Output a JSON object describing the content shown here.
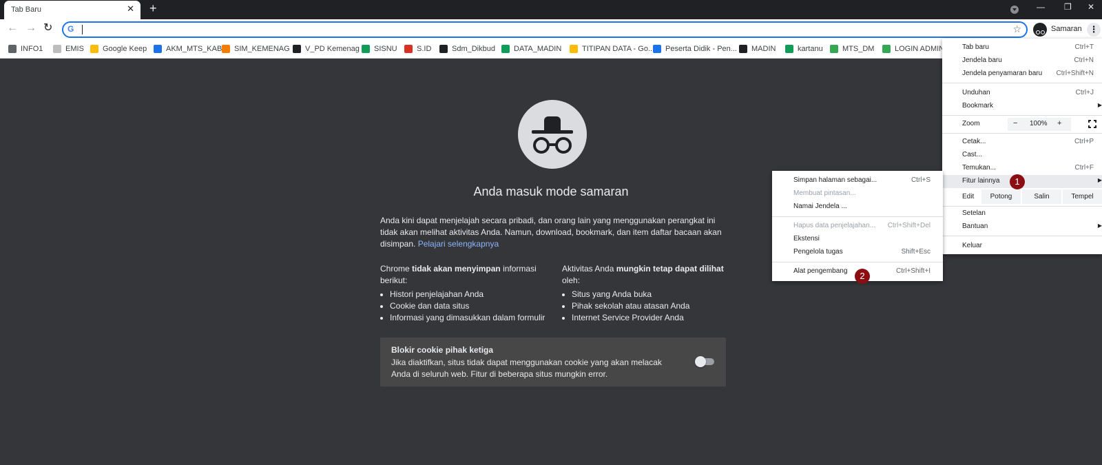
{
  "tab": {
    "title": "Tab Baru",
    "close": "✕",
    "new_tab": "+"
  },
  "window": {
    "minimize": "—",
    "restore": "❐",
    "close": "✕"
  },
  "toolbar": {
    "back": "←",
    "forward": "→",
    "reload": "↻",
    "google_g": "G",
    "address_value": "",
    "bookmark_star": "☆",
    "profile_label": "Samaran",
    "menu_dots": "⋮"
  },
  "bookmarks": [
    {
      "label": "INFO1",
      "color": "#5f6368"
    },
    {
      "label": "EMIS",
      "color": "#bdbdbd"
    },
    {
      "label": "Google Keep",
      "color": "#fbbc04"
    },
    {
      "label": "AKM_MTS_KAB",
      "color": "#1a73e8"
    },
    {
      "label": "SIM_KEMENAG",
      "color": "#f57c00"
    },
    {
      "label": "V_PD Kemenag",
      "color": "#202124"
    },
    {
      "label": "SISNU",
      "color": "#0f9d58"
    },
    {
      "label": "S.ID",
      "color": "#d93025"
    },
    {
      "label": "Sdm_Dikbud",
      "color": "#202124"
    },
    {
      "label": "DATA_MADIN",
      "color": "#0f9d58"
    },
    {
      "label": "TITIPAN DATA - Go...",
      "color": "#fbbc04"
    },
    {
      "label": "Peserta Didik - Pen...",
      "color": "#1a73e8"
    },
    {
      "label": "MADIN",
      "color": "#202124"
    },
    {
      "label": "kartanu",
      "color": "#0f9d58"
    },
    {
      "label": "MTS_DM",
      "color": "#34a853"
    },
    {
      "label": "LOGIN ADMIN",
      "color": "#34a853"
    }
  ],
  "incognito": {
    "heading": "Anda masuk mode samaran",
    "intro": "Anda kini dapat menjelajah secara pribadi, dan orang lain yang menggunakan perangkat ini tidak akan melihat aktivitas Anda. Namun, download, bookmark, dan item daftar bacaan akan disimpan.",
    "learn_more": "Pelajari selengkapnya",
    "left_col": {
      "prefix": "Chrome ",
      "bold": "tidak akan menyimpan",
      "suffix": " informasi berikut:",
      "items": [
        "Histori penjelajahan Anda",
        "Cookie dan data situs",
        "Informasi yang dimasukkan dalam formulir"
      ]
    },
    "right_col": {
      "prefix": "Aktivitas Anda ",
      "bold": "mungkin tetap dapat dilihat",
      "suffix": " oleh:",
      "items": [
        "Situs yang Anda buka",
        "Pihak sekolah atau atasan Anda",
        "Internet Service Provider Anda"
      ]
    },
    "cookie": {
      "title": "Blokir cookie pihak ketiga",
      "desc": "Jika diaktifkan, situs tidak dapat menggunakan cookie yang akan melacak Anda di seluruh web. Fitur di beberapa situs mungkin error.",
      "enabled": false
    }
  },
  "menu": {
    "new_tab": {
      "label": "Tab baru",
      "shortcut": "Ctrl+T"
    },
    "new_window": {
      "label": "Jendela baru",
      "shortcut": "Ctrl+N"
    },
    "new_incognito": {
      "label": "Jendela penyamaran baru",
      "shortcut": "Ctrl+Shift+N"
    },
    "downloads": {
      "label": "Unduhan",
      "shortcut": "Ctrl+J"
    },
    "bookmark": {
      "label": "Bookmark"
    },
    "zoom": {
      "label": "Zoom",
      "minus": "−",
      "value": "100%",
      "plus": "+"
    },
    "print": {
      "label": "Cetak...",
      "shortcut": "Ctrl+P"
    },
    "cast": {
      "label": "Cast..."
    },
    "find": {
      "label": "Temukan...",
      "shortcut": "Ctrl+F"
    },
    "more_tools": {
      "label": "Fitur lainnya"
    },
    "edit": {
      "label": "Edit",
      "cut": "Potong",
      "copy": "Salin",
      "paste": "Tempel"
    },
    "settings": {
      "label": "Setelan"
    },
    "help": {
      "label": "Bantuan"
    },
    "exit": {
      "label": "Keluar"
    },
    "arrow": "▶"
  },
  "submenu": {
    "save_page": {
      "label": "Simpan halaman sebagai...",
      "shortcut": "Ctrl+S"
    },
    "create_shortcut": {
      "label": "Membuat pintasan..."
    },
    "name_window": {
      "label": "Namai Jendela ..."
    },
    "clear_data": {
      "label": "Hapus data penjelajahan...",
      "shortcut": "Ctrl+Shift+Del"
    },
    "extensions": {
      "label": "Ekstensi"
    },
    "task_manager": {
      "label": "Pengelola tugas",
      "shortcut": "Shift+Esc"
    },
    "dev_tools": {
      "label": "Alat pengembang",
      "shortcut": "Ctrl+Shift+I"
    }
  },
  "callouts": [
    "1",
    "2"
  ]
}
